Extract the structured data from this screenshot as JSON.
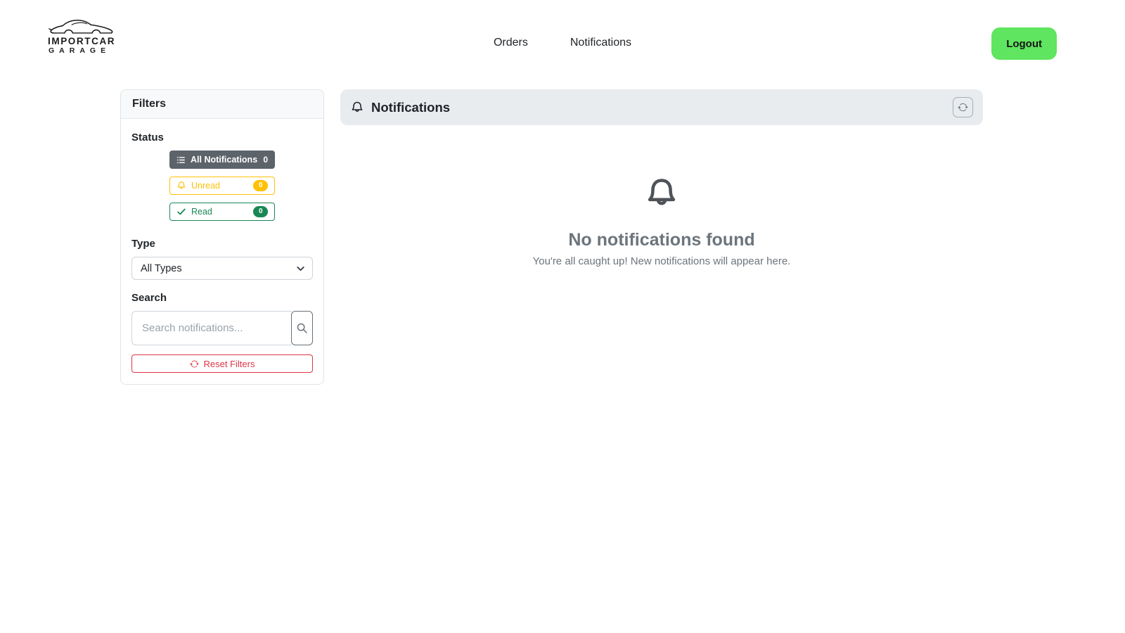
{
  "brand": {
    "name_line1": "IMPORTCAR",
    "name_line2": "GARAGE"
  },
  "nav": {
    "items": [
      {
        "label": "Orders"
      },
      {
        "label": "Notifications"
      }
    ],
    "logout_label": "Logout"
  },
  "filters": {
    "title": "Filters",
    "status": {
      "label": "Status",
      "buttons": [
        {
          "label": "All Notifications",
          "count": "0",
          "icon": "list-icon"
        },
        {
          "label": "Unread",
          "count": "0",
          "icon": "bell-icon"
        },
        {
          "label": "Read",
          "count": "0",
          "icon": "check-icon"
        }
      ]
    },
    "type": {
      "label": "Type",
      "selected_option": "All Types"
    },
    "search": {
      "label": "Search",
      "placeholder": "Search notifications...",
      "icon": "search-icon"
    },
    "reset_label": "Reset Filters"
  },
  "main": {
    "title": "Notifications",
    "icon": "bell-icon",
    "refresh_icon": "refresh-icon",
    "empty_state": {
      "icon": "bell-icon",
      "title": "No notifications found",
      "subtitle": "You're all caught up! New notifications will appear here."
    }
  },
  "colors": {
    "logout_green": "#5fe55f",
    "dark_btn": "#5c636a",
    "warning": "#ffc107",
    "success": "#198754",
    "danger": "#dc3545",
    "bar_gray": "#e9ecef"
  }
}
